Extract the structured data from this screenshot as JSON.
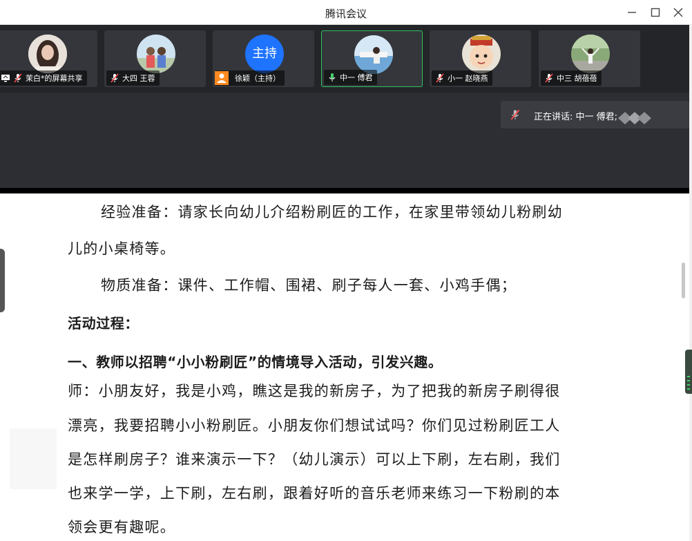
{
  "window": {
    "title": "腾讯会议"
  },
  "participants": [
    {
      "name": "茉白*的屏幕共享",
      "sharing": true
    },
    {
      "name": "大四 王蓉"
    },
    {
      "name": "徐颖（主持）",
      "host": true,
      "avatar_text": "主持"
    },
    {
      "name": "中一 傅君",
      "speaking": true
    },
    {
      "name": "小一 赵晓燕"
    },
    {
      "name": "中三 胡蓓蓓"
    }
  ],
  "speaking": {
    "text": "正在讲话: 中一 傅君;"
  },
  "document": {
    "lines": [
      "经验准备：请家长向幼儿介绍粉刷匠的工作，在家里带领幼儿粉刷幼",
      "儿的小桌椅等。",
      "物质准备：课件、工作帽、围裙、刷子每人一套、小鸡手偶；",
      "活动过程：",
      "一、教师以招聘“小小粉刷匠”的情境导入活动，引发兴趣。",
      "师：小朋友好，我是小鸡，瞧这是我的新房子，为了把我的新房子刷得很",
      "漂亮，我要招聘小小粉刷匠。小朋友你们想试试吗？你们见过粉刷匠工人",
      "是怎样刷房子？谁来演示一下？（幼儿演示）可以上下刷，左右刷，我们",
      "也来学一学，上下刷，左右刷，跟着好听的音乐老师来练习一下粉刷的本",
      "领会更有趣呢。"
    ]
  },
  "colors": {
    "host_avatar": "#1e73ff",
    "speaking_border": "#30c35c",
    "host_badge": "#ff8a1f"
  }
}
